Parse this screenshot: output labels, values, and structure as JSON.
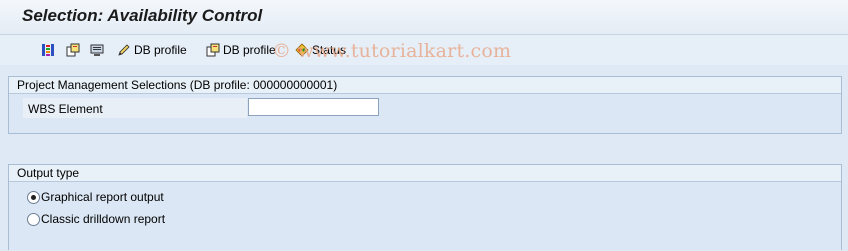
{
  "title": "Selection: Availability Control",
  "watermark": "© www.tutorialkart.com",
  "toolbar": {
    "db_profile_1": "DB profile",
    "db_profile_2": "DB profile",
    "status": "Status"
  },
  "pm_group": {
    "header": "Project Management Selections (DB profile: 000000000001)",
    "wbs_label": "WBS Element",
    "wbs_value": ""
  },
  "output_group": {
    "header": "Output type",
    "options": [
      {
        "label": "Graphical report output",
        "selected": true
      },
      {
        "label": "Classic drilldown report",
        "selected": false
      }
    ]
  },
  "colors": {
    "accent": "#dfe9f5",
    "group_border": "#a9bdd4"
  }
}
